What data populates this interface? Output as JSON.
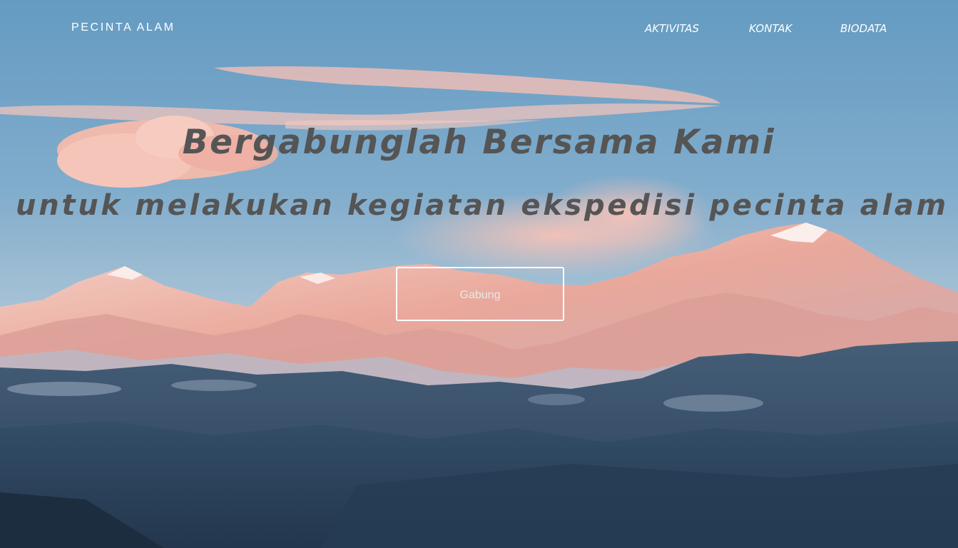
{
  "brand": {
    "name": "PECINTA ALAM"
  },
  "nav": {
    "items": [
      {
        "label": "AKTIVITAS"
      },
      {
        "label": "KONTAK"
      },
      {
        "label": "BIODATA"
      }
    ]
  },
  "hero": {
    "headline": "Bergabunglah Bersama Kami",
    "subheadline": "untuk melakukan kegiatan ekspedisi pecinta alam",
    "cta_label": "Gabung",
    "background_image": "mountain-landscape-at-sunrise"
  },
  "colors": {
    "sky_top": "#5b95bf",
    "sky_bottom": "#a9c3d6",
    "cloud_pink": "#f3b4a6",
    "peak_pink": "#e59a8b",
    "forest_dark": "#1d3651",
    "headline_text": "#555555",
    "nav_text": "#ffffff"
  }
}
